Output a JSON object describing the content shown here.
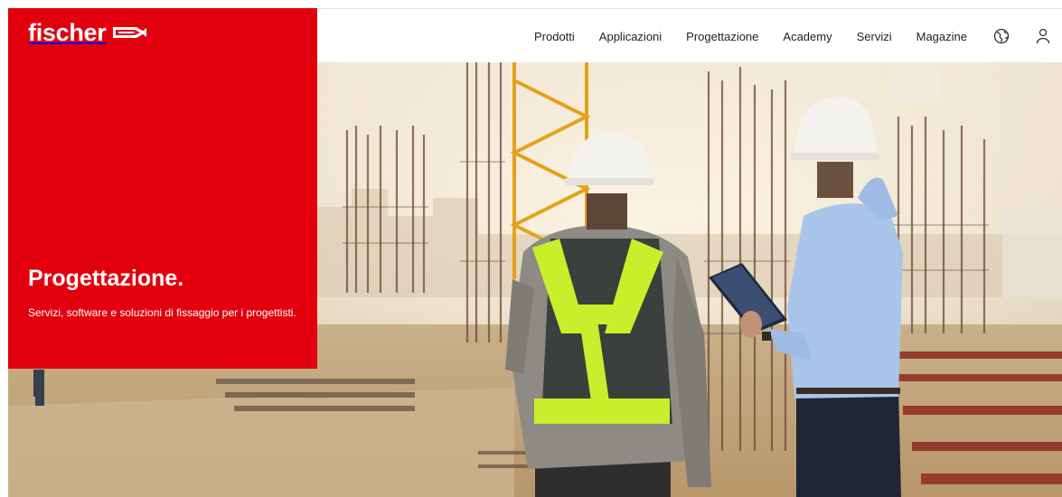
{
  "brand": {
    "name": "fischer",
    "brand_color": "#e2000f"
  },
  "nav": {
    "items": [
      {
        "label": "Prodotti"
      },
      {
        "label": "Applicazioni"
      },
      {
        "label": "Progettazione"
      },
      {
        "label": "Academy"
      },
      {
        "label": "Servizi"
      },
      {
        "label": "Magazine"
      }
    ],
    "icons": [
      "globe-icon",
      "user-icon"
    ]
  },
  "hero": {
    "title": "Progettazione.",
    "subtitle": "Servizi, software e soluzioni di fissaggio per i progettisti.",
    "image": "construction-site-engineers-photo"
  }
}
